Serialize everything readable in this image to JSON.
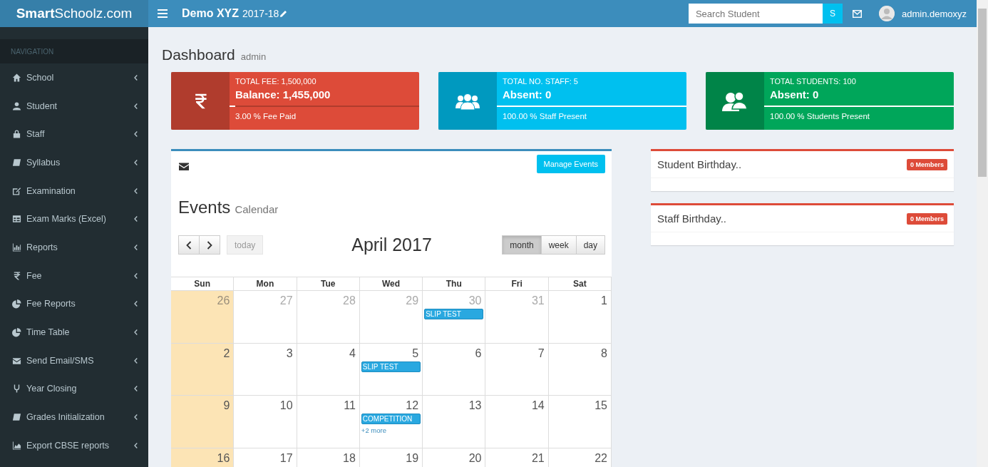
{
  "header": {
    "logo_bold": "Smart",
    "logo_rest": "Schoolz.com",
    "school": "Demo XYZ",
    "session": "2017-18",
    "search_placeholder": "Search Student",
    "search_button": "S",
    "user": "admin.demoxyz"
  },
  "sidebar": {
    "heading": "NAVIGATION",
    "items": [
      {
        "label": "School"
      },
      {
        "label": "Student"
      },
      {
        "label": "Staff"
      },
      {
        "label": "Syllabus"
      },
      {
        "label": "Examination"
      },
      {
        "label": "Exam Marks (Excel)"
      },
      {
        "label": "Reports"
      },
      {
        "label": "Fee"
      },
      {
        "label": "Fee Reports"
      },
      {
        "label": "Time Table"
      },
      {
        "label": "Send Email/SMS"
      },
      {
        "label": "Year Closing"
      },
      {
        "label": "Grades Initialization"
      },
      {
        "label": "Export CBSE reports"
      }
    ]
  },
  "page": {
    "title": "Dashboard",
    "subtitle": "admin"
  },
  "info_boxes": [
    {
      "color": "#dd4b39",
      "line1": "TOTAL FEE: 1,500,000",
      "line2": "Balance: 1,455,000",
      "level": 0.03,
      "footer": "3.00 % Fee Paid"
    },
    {
      "color": "#00c0ef",
      "line1": "TOTAL NO. STAFF: 5",
      "line2": "Absent: 0",
      "level": 1,
      "footer": "100.00 % Staff Present"
    },
    {
      "color": "#00a65a",
      "line1": "TOTAL STUDENTS: 100",
      "line2": "Absent: 0",
      "level": 1,
      "footer": "100.00 % Students Present"
    }
  ],
  "calendar": {
    "manage_button": "Manage Events",
    "title": "Events",
    "subtitle": "Calendar",
    "today": {
      "label": "today",
      "disabled": true
    },
    "month_title": "April 2017",
    "views": [
      {
        "label": "month",
        "selected": true
      },
      {
        "label": "week",
        "selected": false
      },
      {
        "label": "day",
        "selected": false
      }
    ],
    "weekdays": [
      "Sun",
      "Mon",
      "Tue",
      "Wed",
      "Thu",
      "Fri",
      "Sat"
    ],
    "weeks": [
      [
        {
          "day": "26",
          "other_month": true,
          "highlighted": true
        },
        {
          "day": "27",
          "other_month": true,
          "highlighted": false
        },
        {
          "day": "28",
          "other_month": true,
          "highlighted": false
        },
        {
          "day": "29",
          "other_month": true,
          "highlighted": false
        },
        {
          "day": "30",
          "other_month": true,
          "highlighted": false,
          "events": [
            {
              "title": "SLIP TEST"
            }
          ]
        },
        {
          "day": "31",
          "other_month": true,
          "highlighted": false
        },
        {
          "day": "1",
          "other_month": false,
          "highlighted": false
        }
      ],
      [
        {
          "day": "2",
          "other_month": false,
          "highlighted": true
        },
        {
          "day": "3",
          "other_month": false,
          "highlighted": false
        },
        {
          "day": "4",
          "other_month": false,
          "highlighted": false
        },
        {
          "day": "5",
          "other_month": false,
          "highlighted": false,
          "events": [
            {
              "title": "SLIP TEST"
            }
          ]
        },
        {
          "day": "6",
          "other_month": false,
          "highlighted": false
        },
        {
          "day": "7",
          "other_month": false,
          "highlighted": false
        },
        {
          "day": "8",
          "other_month": false,
          "highlighted": false
        }
      ],
      [
        {
          "day": "9",
          "other_month": false,
          "highlighted": true
        },
        {
          "day": "10",
          "other_month": false,
          "highlighted": false
        },
        {
          "day": "11",
          "other_month": false,
          "highlighted": false
        },
        {
          "day": "12",
          "other_month": false,
          "highlighted": false,
          "events": [
            {
              "title": "COMPETITION"
            }
          ],
          "more": "+2 more"
        },
        {
          "day": "13",
          "other_month": false,
          "highlighted": false
        },
        {
          "day": "14",
          "other_month": false,
          "highlighted": false
        },
        {
          "day": "15",
          "other_month": false,
          "highlighted": false
        }
      ],
      [
        {
          "day": "16",
          "other_month": false,
          "highlighted": true
        },
        {
          "day": "17",
          "other_month": false,
          "highlighted": false
        },
        {
          "day": "18",
          "other_month": false,
          "highlighted": false
        },
        {
          "day": "19",
          "other_month": false,
          "highlighted": false
        },
        {
          "day": "20",
          "other_month": false,
          "highlighted": false
        },
        {
          "day": "21",
          "other_month": false,
          "highlighted": false
        },
        {
          "day": "22",
          "other_month": false,
          "highlighted": false
        }
      ]
    ]
  },
  "birthday_panels": [
    {
      "title": "Student Birthday..",
      "badge": "0 Members"
    },
    {
      "title": "Staff Birthday..",
      "badge": "0 Members"
    }
  ]
}
